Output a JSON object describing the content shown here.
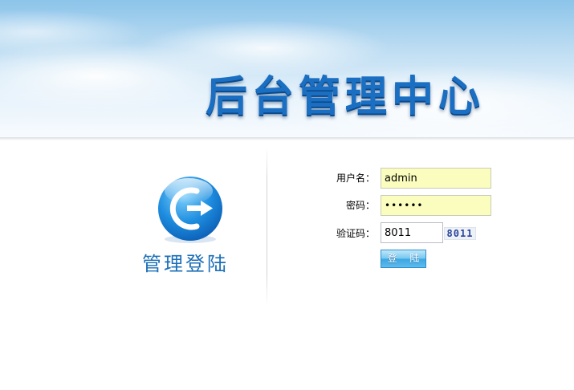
{
  "header": {
    "system_title": "后台管理中心"
  },
  "logo": {
    "caption": "管理登陆",
    "icon": "login-arrow-icon"
  },
  "form": {
    "username_label": "用户名：",
    "username_value": "admin",
    "password_label": "密码：",
    "password_value": "••••••",
    "captcha_label": "验证码：",
    "captcha_value": "8011",
    "captcha_image_text": "8011",
    "login_button": "登 陆"
  },
  "colors": {
    "title_blue": "#1a6fc2",
    "field_yellow": "#fbfdbe",
    "button_blue": "#3aa6e0"
  }
}
